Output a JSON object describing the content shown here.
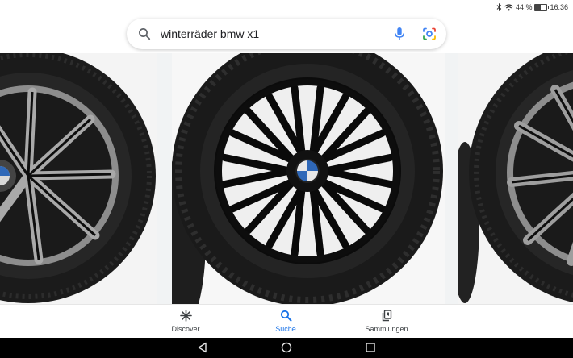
{
  "status_bar": {
    "battery_percent": "44 %",
    "battery_level": 0.44,
    "time": "16:36",
    "icons": [
      "bluetooth-icon",
      "wifi-icon",
      "battery-icon"
    ]
  },
  "search": {
    "query": "winterräder bmw x1",
    "icons": [
      "search-icon",
      "mic-icon",
      "google-lens-icon"
    ]
  },
  "results": [
    {
      "description": "wheel-left"
    },
    {
      "description": "wheel-center"
    },
    {
      "description": "wheel-right"
    }
  ],
  "bottom_nav": {
    "items": [
      {
        "label": "Discover",
        "icon": "asterisk-icon",
        "active": false
      },
      {
        "label": "Suche",
        "icon": "search-icon",
        "active": true
      },
      {
        "label": "Sammlungen",
        "icon": "collections-icon",
        "active": false
      }
    ]
  },
  "colors": {
    "accent": "#1a73e8",
    "mic_blue": "#4285f4",
    "system_nav": "#000000"
  },
  "system_nav": {
    "icons": [
      "back-icon",
      "home-icon",
      "recents-icon"
    ]
  }
}
